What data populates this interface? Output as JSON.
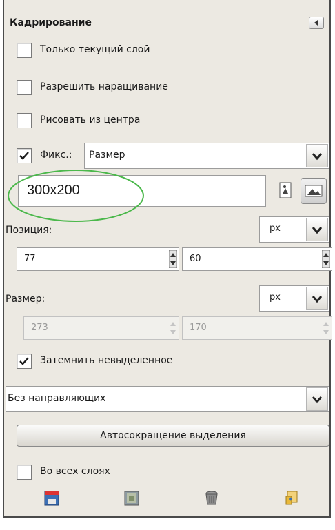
{
  "panel": {
    "title": "Кадрирование"
  },
  "options": {
    "current_layer_only": {
      "label": "Только текущий слой",
      "checked": false
    },
    "allow_growing": {
      "label": "Разрешить наращивание",
      "checked": false
    },
    "expand_from_center": {
      "label": "Рисовать из центра",
      "checked": false
    },
    "fixed": {
      "label": "Фикс.:",
      "checked": true,
      "mode": "Размер"
    },
    "fixed_value": "300x200",
    "position": {
      "label": "Позиция:",
      "unit": "px",
      "x": "77",
      "y": "60"
    },
    "size": {
      "label": "Размер:",
      "unit": "px",
      "w": "273",
      "h": "170"
    },
    "highlight": {
      "label": "Затемнить невыделенное",
      "checked": true
    },
    "guides": "Без направляющих",
    "auto_shrink_label": "Автосокращение выделения",
    "shrink_merged": {
      "label": "Во всех слоях",
      "checked": false
    }
  },
  "icons": {
    "collapse": "collapse-left-icon",
    "portrait": "portrait-icon",
    "landscape": "landscape-icon",
    "save": "save-preset-icon",
    "restore": "restore-icon",
    "delete": "delete-icon",
    "reset": "reset-icon"
  },
  "colors": {
    "highlight_ellipse": "#4bb84b",
    "check": "#1a1a1a"
  }
}
